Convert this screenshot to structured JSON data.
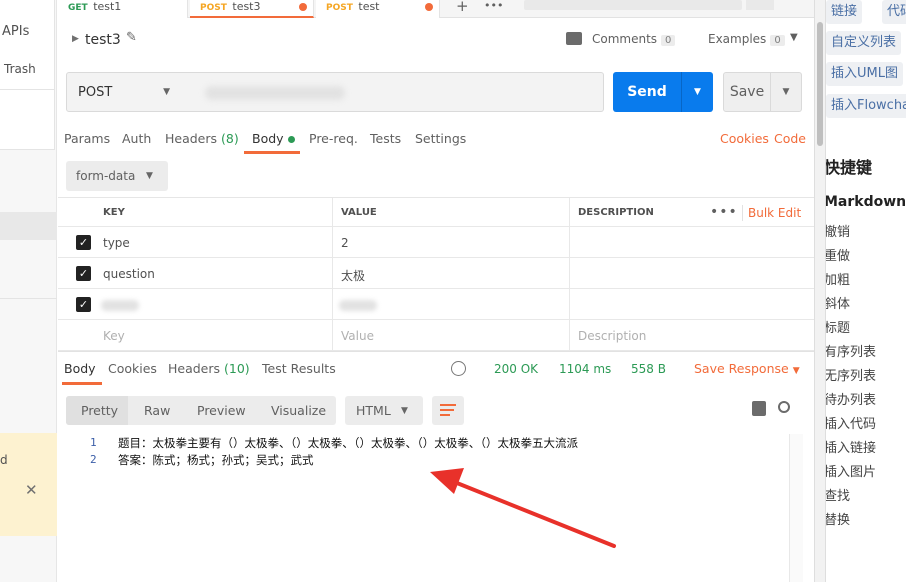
{
  "sidebar": {
    "apis_label": "APIs",
    "trash_label": "Trash",
    "notice_fragment": "d",
    "notice_close": "✕"
  },
  "tabs": [
    {
      "method": "GET",
      "name": "test1",
      "unsaved": false
    },
    {
      "method": "POST",
      "name": "test3",
      "unsaved": true,
      "active": true
    },
    {
      "method": "POST",
      "name": "test",
      "unsaved": true
    }
  ],
  "tabbar": {
    "add": "+",
    "more": "•••"
  },
  "request": {
    "name": "test3",
    "comments_label": "Comments",
    "comments_count": "0",
    "examples_label": "Examples",
    "examples_count": "0",
    "method": "POST",
    "send_label": "Send",
    "save_label": "Save"
  },
  "request_tabs": {
    "params": "Params",
    "auth": "Auth",
    "headers": "Headers",
    "headers_count": "(8)",
    "body": "Body",
    "prereq": "Pre-req.",
    "tests": "Tests",
    "settings": "Settings",
    "cookies": "Cookies",
    "code": "Code"
  },
  "body": {
    "mode": "form-data",
    "columns": {
      "key": "KEY",
      "value": "VALUE",
      "description": "DESCRIPTION"
    },
    "bulk_edit": "Bulk Edit",
    "rows": [
      {
        "key": "type",
        "value": "2",
        "checked": true
      },
      {
        "key": "question",
        "value": "太极",
        "checked": true
      }
    ],
    "placeholders": {
      "key": "Key",
      "value": "Value",
      "description": "Description"
    }
  },
  "response": {
    "tabs": {
      "body": "Body",
      "cookies": "Cookies",
      "headers": "Headers",
      "headers_count": "(10)",
      "test_results": "Test Results"
    },
    "status": "200 OK",
    "time": "1104 ms",
    "size": "558 B",
    "save_response": "Save Response",
    "views": {
      "pretty": "Pretty",
      "raw": "Raw",
      "preview": "Preview",
      "visualize": "Visualize"
    },
    "format": "HTML",
    "lines": [
      {
        "n": "1",
        "text": "题目：太极拳主要有（）太极拳、（）太极拳、（）太极拳、（）太极拳、（）太极拳五大流派"
      },
      {
        "n": "2",
        "text": "答案：陈式；杨式；孙式；吴式；武式"
      }
    ]
  },
  "right_panel": {
    "tags": [
      "链接",
      "代码",
      "自定义列表",
      "插入UML图",
      "插入Flowchart"
    ],
    "heading1": "快捷键",
    "heading2": "Markdown",
    "items": [
      "撤销",
      "重做",
      "加粗",
      "斜体",
      "标题",
      "有序列表",
      "无序列表",
      "待办列表",
      "插入代码",
      "插入链接",
      "插入图片",
      "查找",
      "替换"
    ]
  },
  "colors": {
    "accent": "#f26b3a",
    "send": "#097bed",
    "success": "#2c9a55",
    "annotation_arrow": "#e8312a"
  }
}
